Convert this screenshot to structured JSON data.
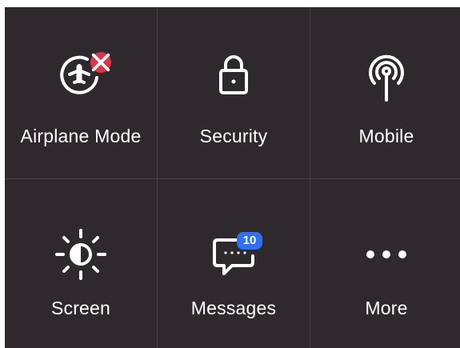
{
  "tiles": [
    {
      "label": "Airplane Mode",
      "icon": "airplane-icon",
      "badge_icon": "close-icon"
    },
    {
      "label": "Security",
      "icon": "lock-icon"
    },
    {
      "label": "Mobile",
      "icon": "antenna-icon"
    },
    {
      "label": "Screen",
      "icon": "brightness-icon"
    },
    {
      "label": "Messages",
      "icon": "message-icon",
      "badge": "10"
    },
    {
      "label": "More",
      "icon": "more-dots-icon"
    }
  ],
  "colors": {
    "background": "#2e292d",
    "divider": "#4a4449",
    "text": "#ffffff",
    "alert_badge": "#d9364a",
    "count_badge": "#2f6ff0"
  }
}
